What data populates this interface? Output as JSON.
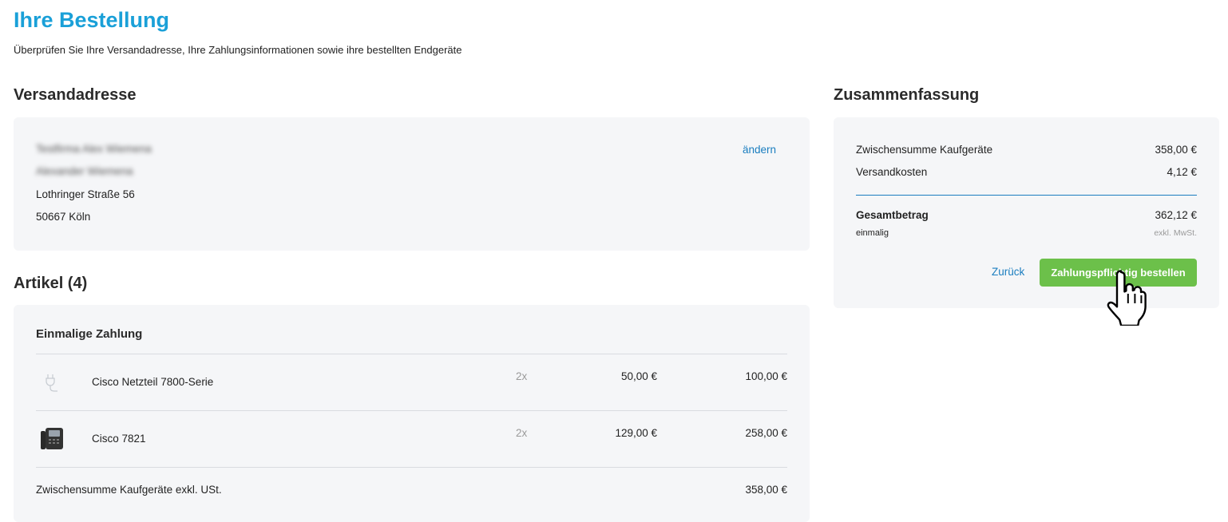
{
  "header": {
    "title": "Ihre Bestellung",
    "subtitle": "Überprüfen Sie Ihre Versandadresse, Ihre Zahlungsinformationen sowie ihre bestellten Endgeräte"
  },
  "shipping": {
    "title": "Versandadresse",
    "name_line_1": "Testfirma Alex Wiemena",
    "name_line_2": "Alexander Wiemena",
    "street": "Lothringer Straße 56",
    "city": "50667 Köln",
    "change_link": "ändern"
  },
  "articles": {
    "title": "Artikel (4)",
    "group_title": "Einmalige Zahlung",
    "items": [
      {
        "name": "Cisco Netzteil 7800-Serie",
        "qty": "2x",
        "unit_price": "50,00 €",
        "total": "100,00 €",
        "icon": "power-adapter-icon"
      },
      {
        "name": "Cisco 7821",
        "qty": "2x",
        "unit_price": "129,00 €",
        "total": "258,00 €",
        "icon": "desk-phone-icon"
      }
    ],
    "subtotal_label": "Zwischensumme Kaufgeräte exkl. USt.",
    "subtotal_value": "358,00 €"
  },
  "summary": {
    "title": "Zusammenfassung",
    "subtotal_label": "Zwischensumme Kaufgeräte",
    "subtotal_value": "358,00 €",
    "shipping_label": "Versandkosten",
    "shipping_value": "4,12 €",
    "total_label": "Gesamtbetrag",
    "total_value": "362,12 €",
    "total_note": "einmalig",
    "tax_note": "exkl. MwSt.",
    "back_label": "Zurück",
    "order_label": "Zahlungspflichtig bestellen"
  },
  "colors": {
    "title_blue": "#1aa0d8",
    "link_blue": "#1a7dbf",
    "button_green": "#6cc04a",
    "card_bg": "#f5f6f8"
  }
}
